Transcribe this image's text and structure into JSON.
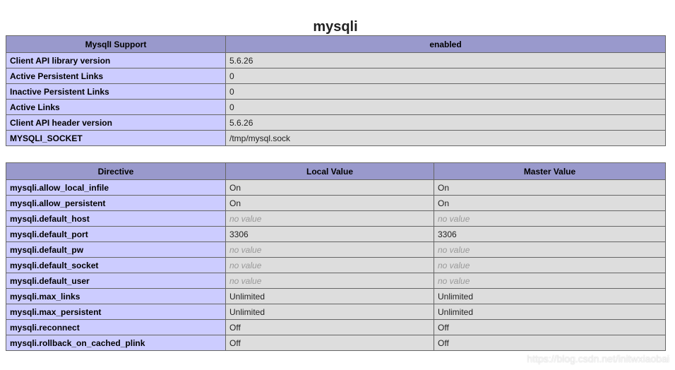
{
  "title": "mysqli",
  "support_table": {
    "header": [
      "MysqlI Support",
      "enabled"
    ],
    "rows": [
      {
        "label": "Client API library version",
        "value": "5.6.26"
      },
      {
        "label": "Active Persistent Links",
        "value": "0"
      },
      {
        "label": "Inactive Persistent Links",
        "value": "0"
      },
      {
        "label": "Active Links",
        "value": "0"
      },
      {
        "label": "Client API header version",
        "value": "5.6.26"
      },
      {
        "label": "MYSQLI_SOCKET",
        "value": "/tmp/mysql.sock"
      }
    ]
  },
  "directive_table": {
    "header": [
      "Directive",
      "Local Value",
      "Master Value"
    ],
    "rows": [
      {
        "name": "mysqli.allow_local_infile",
        "local": "On",
        "master": "On"
      },
      {
        "name": "mysqli.allow_persistent",
        "local": "On",
        "master": "On"
      },
      {
        "name": "mysqli.default_host",
        "local": "no value",
        "master": "no value"
      },
      {
        "name": "mysqli.default_port",
        "local": "3306",
        "master": "3306"
      },
      {
        "name": "mysqli.default_pw",
        "local": "no value",
        "master": "no value"
      },
      {
        "name": "mysqli.default_socket",
        "local": "no value",
        "master": "no value"
      },
      {
        "name": "mysqli.default_user",
        "local": "no value",
        "master": "no value"
      },
      {
        "name": "mysqli.max_links",
        "local": "Unlimited",
        "master": "Unlimited"
      },
      {
        "name": "mysqli.max_persistent",
        "local": "Unlimited",
        "master": "Unlimited"
      },
      {
        "name": "mysqli.reconnect",
        "local": "Off",
        "master": "Off"
      },
      {
        "name": "mysqli.rollback_on_cached_plink",
        "local": "Off",
        "master": "Off"
      }
    ]
  },
  "watermark": "https://blog.csdn.net/initwxiaobai",
  "colors": {
    "header_bg": "#9999cc",
    "label_bg": "#ccccff",
    "value_bg": "#dddddd",
    "no_value_text": "#999999",
    "border": "#666666"
  }
}
